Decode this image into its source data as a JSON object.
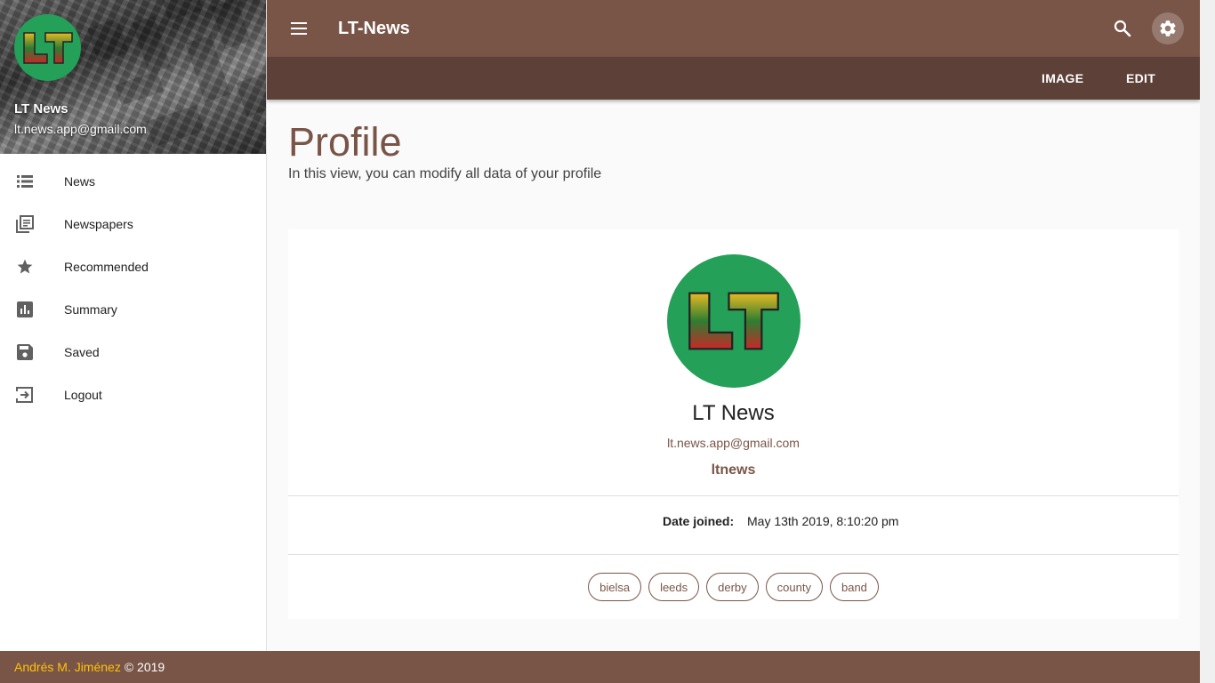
{
  "drawer": {
    "user_name": "LT News",
    "user_email": "lt.news.app@gmail.com",
    "avatar_text": "LT",
    "items": [
      {
        "label": "News",
        "icon": "list-icon"
      },
      {
        "label": "Newspapers",
        "icon": "newspaper-icon"
      },
      {
        "label": "Recommended",
        "icon": "star-icon"
      },
      {
        "label": "Summary",
        "icon": "bar-chart-icon"
      },
      {
        "label": "Saved",
        "icon": "save-icon"
      },
      {
        "label": "Logout",
        "icon": "logout-icon"
      }
    ]
  },
  "appbar": {
    "title": "LT-News",
    "image_label": "IMAGE",
    "edit_label": "EDIT"
  },
  "main": {
    "title": "Profile",
    "subtitle": "In this view, you can modify all data of your profile"
  },
  "profile": {
    "name": "LT News",
    "email": "lt.news.app@gmail.com",
    "username": "ltnews",
    "date_label": "Date joined:",
    "date_value": "May 13th 2019, 8:10:20 pm",
    "tags": [
      "bielsa",
      "leeds",
      "derby",
      "county",
      "band"
    ]
  },
  "footer": {
    "author": "Andrés M. Jiménez",
    "copyright": "© 2019"
  },
  "colors": {
    "primary": "#795548",
    "primary_dark": "#5d4037",
    "avatar_bg": "#24a058",
    "footer_accent": "#ffc107"
  }
}
